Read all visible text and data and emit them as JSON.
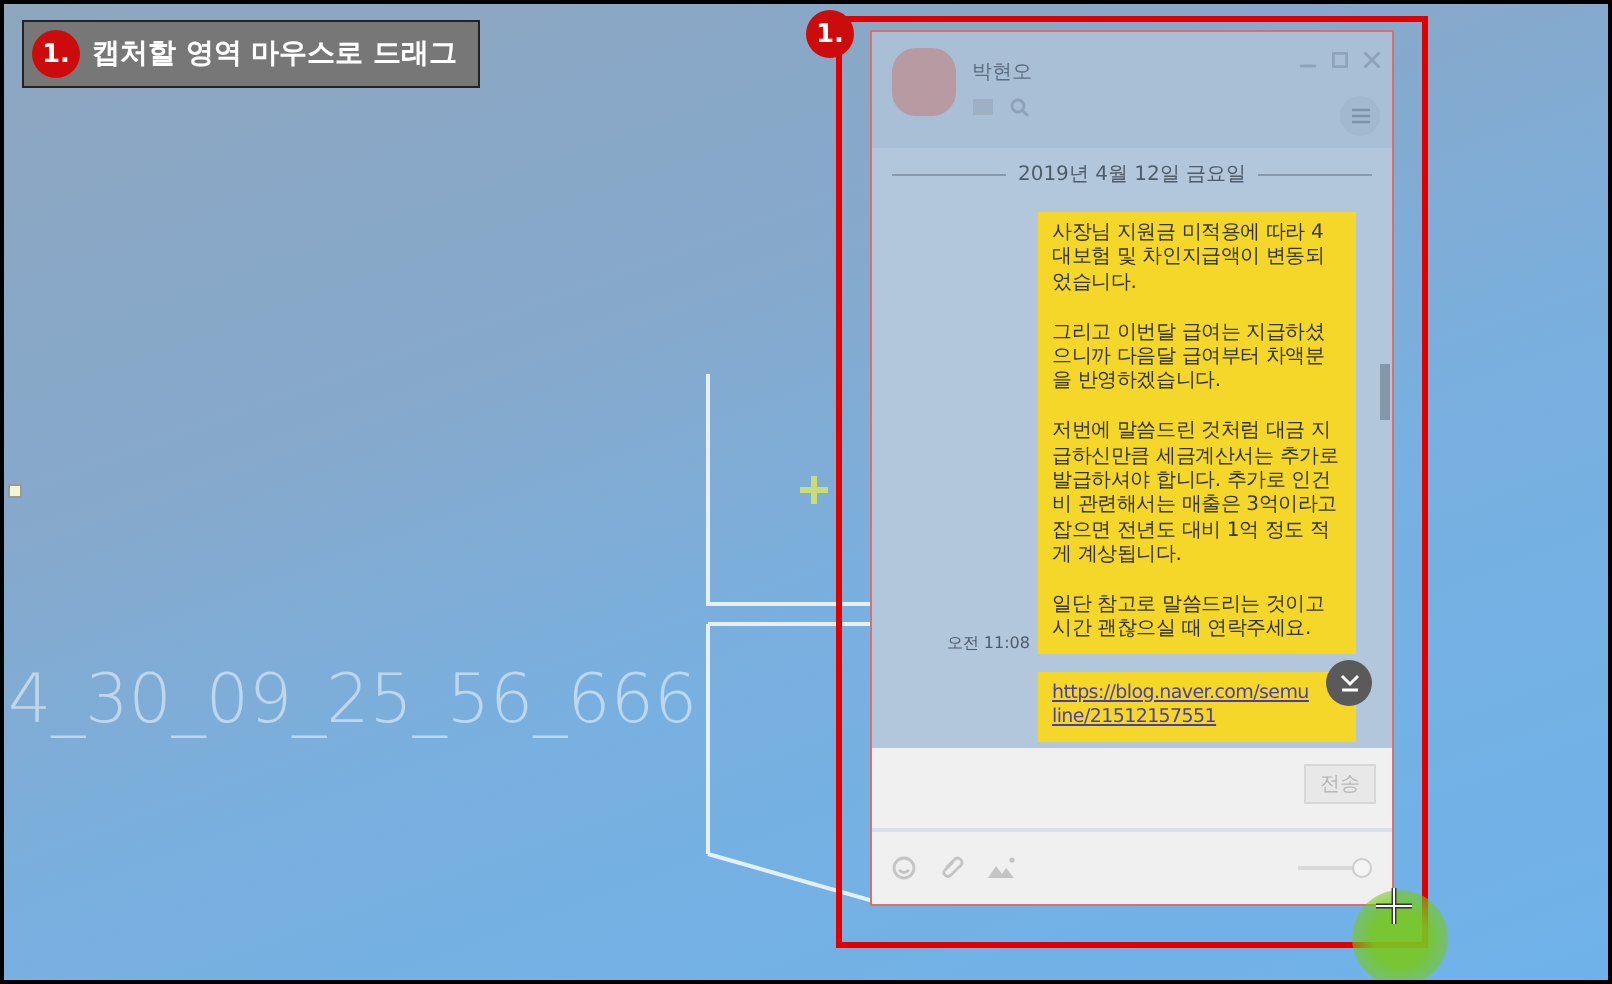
{
  "annotation": {
    "badge": "1.",
    "text": "캡처할 영역 마우스로 드래그"
  },
  "desktop": {
    "overlay_text": "4_30_09_25_56_666"
  },
  "selection": {
    "badge": "1."
  },
  "chat_window": {
    "contact_name": "박현오",
    "date_divider": "2019년 4월 12일 금요일",
    "messages": [
      {
        "kind": "text",
        "time": "오전 11:08",
        "paragraphs": [
          "사장님 지원금 미적용에 따라 4대보험 및 차인지급액이 변동되었습니다.",
          "그리고 이번달 급여는 지급하셨으니까 다음달 급여부터 차액분을 반영하겠습니다.",
          "저번에 말씀드린 것처럼 대금 지급하신만큼 세금계산서는 추가로 발급하셔야 합니다. 추가로 인건비 관련해서는 매출은 3억이라고 잡으면 전년도 대비 1억 정도 적게 계상됩니다.",
          "일단 참고로 말씀드리는 것이고 시간 괜찮으실 때 연락주세요."
        ]
      },
      {
        "kind": "link",
        "url": "https://blog.naver.com/semuline/21512157551"
      }
    ],
    "send_button": {
      "label": "전송",
      "disabled": true
    },
    "zoom_slider": {
      "level": 1.0
    }
  }
}
